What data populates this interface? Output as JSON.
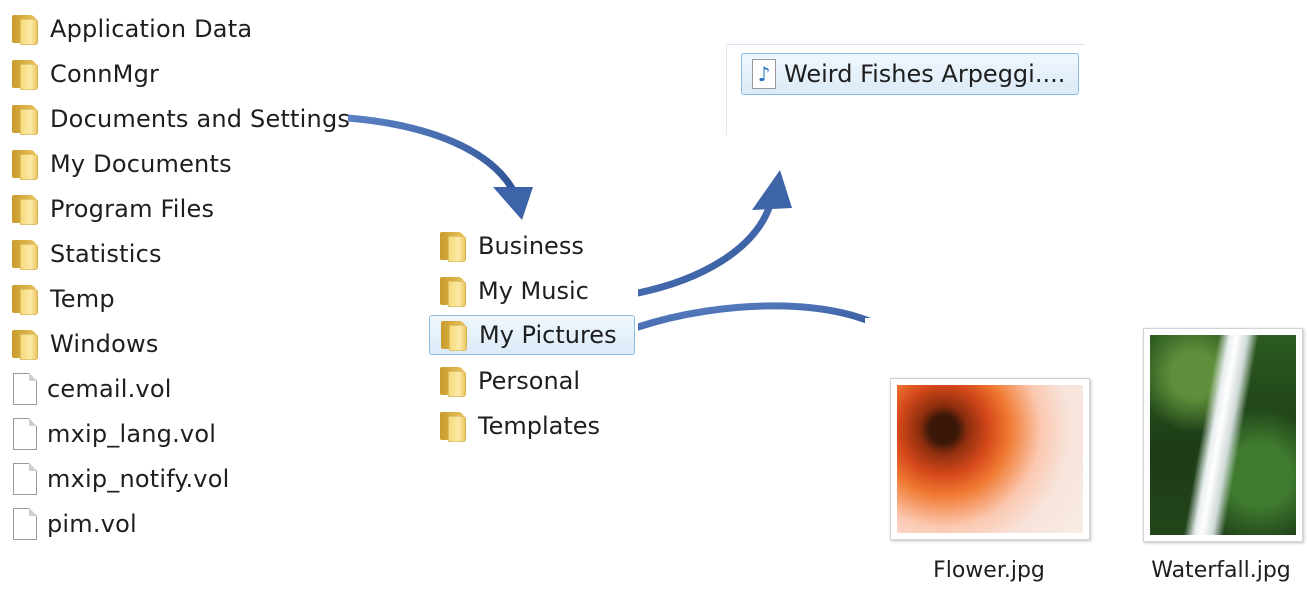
{
  "root_listing": {
    "items": [
      {
        "label": "Application Data",
        "kind": "folder"
      },
      {
        "label": "ConnMgr",
        "kind": "folder"
      },
      {
        "label": "Documents and Settings",
        "kind": "folder"
      },
      {
        "label": "My Documents",
        "kind": "folder"
      },
      {
        "label": "Program Files",
        "kind": "folder"
      },
      {
        "label": "Statistics",
        "kind": "folder"
      },
      {
        "label": "Temp",
        "kind": "folder"
      },
      {
        "label": "Windows",
        "kind": "folder"
      },
      {
        "label": "cemail.vol",
        "kind": "file"
      },
      {
        "label": "mxip_lang.vol",
        "kind": "file"
      },
      {
        "label": "mxip_notify.vol",
        "kind": "file"
      },
      {
        "label": "pim.vol",
        "kind": "file"
      }
    ]
  },
  "sub_listing": {
    "items": [
      {
        "label": "Business",
        "kind": "folder",
        "selected": false
      },
      {
        "label": "My Music",
        "kind": "folder",
        "selected": false
      },
      {
        "label": "My Pictures",
        "kind": "folder",
        "selected": true
      },
      {
        "label": "Personal",
        "kind": "folder",
        "selected": false
      },
      {
        "label": "Templates",
        "kind": "folder",
        "selected": false
      }
    ]
  },
  "music_listing": {
    "item": {
      "label": "Weird Fishes Arpeggi....",
      "icon": "music-file-icon"
    }
  },
  "pictures_listing": {
    "items": [
      {
        "label": "Flower.jpg",
        "icon": "flower-thumbnail"
      },
      {
        "label": "Waterfall.jpg",
        "icon": "waterfall-thumbnail"
      }
    ]
  },
  "colors": {
    "arrow": "#3d64a8",
    "selection_border": "#8cbbe6",
    "folder": "#f0c75a"
  }
}
